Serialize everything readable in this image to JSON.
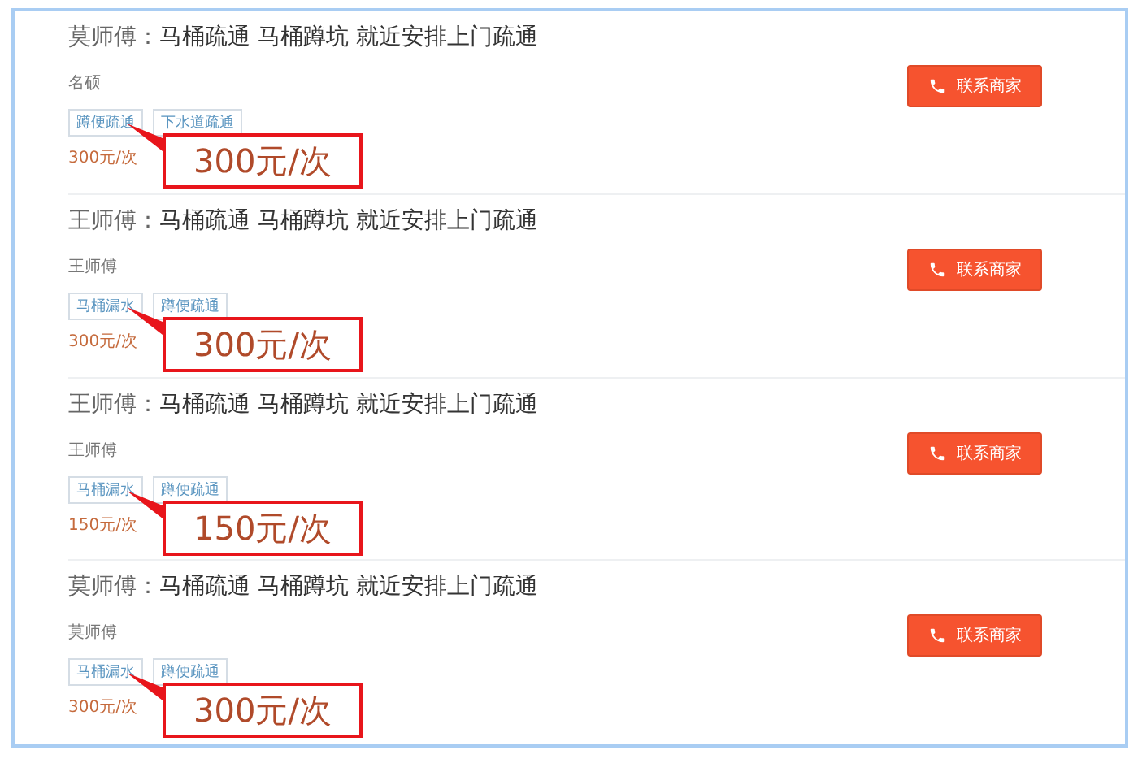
{
  "listings": [
    {
      "name": "莫师傅",
      "separator": "：",
      "title": "马桶疏通 马桶蹲坑 就近安排上门疏通",
      "subtitle": "名硕",
      "tags": [
        "蹲便疏通",
        "下水道疏通"
      ],
      "price": "300元/次",
      "callout": "300元/次",
      "button": "联系商家"
    },
    {
      "name": "王师傅",
      "separator": "：",
      "title": "马桶疏通 马桶蹲坑 就近安排上门疏通",
      "subtitle": "王师傅",
      "tags": [
        "马桶漏水",
        "蹲便疏通"
      ],
      "price": "300元/次",
      "callout": "300元/次",
      "button": "联系商家"
    },
    {
      "name": "王师傅",
      "separator": "：",
      "title": "马桶疏通 马桶蹲坑 就近安排上门疏通",
      "subtitle": "王师傅",
      "tags": [
        "马桶漏水",
        "蹲便疏通"
      ],
      "price": "150元/次",
      "callout": "150元/次",
      "button": "联系商家"
    },
    {
      "name": "莫师傅",
      "separator": "：",
      "title": "马桶疏通 马桶蹲坑 就近安排上门疏通",
      "subtitle": "莫师傅",
      "tags": [
        "马桶漏水",
        "蹲便疏通"
      ],
      "price": "300元/次",
      "callout": "300元/次",
      "button": "联系商家"
    }
  ]
}
